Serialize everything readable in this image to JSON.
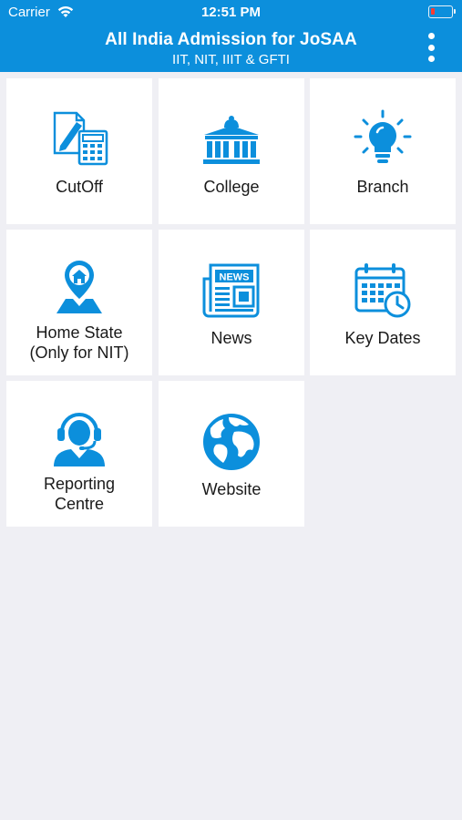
{
  "status_bar": {
    "carrier": "Carrier",
    "time": "12:51 PM",
    "battery_color": "#ff3b30"
  },
  "header": {
    "title": "All India Admission for JoSAA",
    "subtitle": "IIT, NIT, IIIT & GFTI",
    "background": "#0c8fdc",
    "menu_icon": "more-vertical-icon"
  },
  "tiles": [
    {
      "label": "CutOff",
      "icon": "document-calculator-icon"
    },
    {
      "label": "College",
      "icon": "college-building-icon"
    },
    {
      "label": "Branch",
      "icon": "lightbulb-icon"
    },
    {
      "label_line1": "Home State",
      "label_line2": "(Only for NIT)",
      "icon": "location-pin-home-icon"
    },
    {
      "label": "News",
      "icon": "newspaper-icon"
    },
    {
      "label": "Key Dates",
      "icon": "calendar-clock-icon"
    },
    {
      "label_line1": "Reporting",
      "label_line2": "Centre",
      "icon": "headset-agent-icon"
    },
    {
      "label": "Website",
      "icon": "globe-icon"
    }
  ],
  "icon_color": "#0c8fdc"
}
